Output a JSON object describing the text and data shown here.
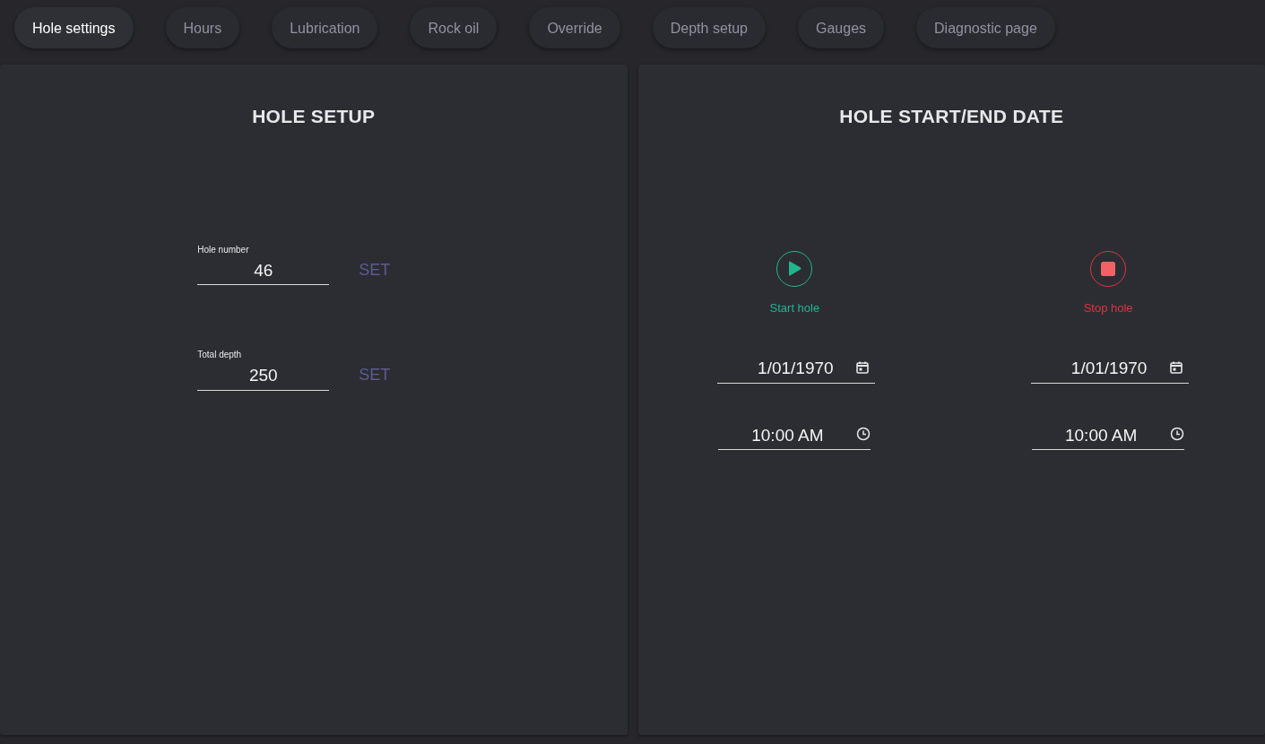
{
  "tabs": [
    {
      "label": "Hole settings",
      "selected": true
    },
    {
      "label": "Hours",
      "selected": false
    },
    {
      "label": "Lubrication",
      "selected": false
    },
    {
      "label": "Rock oil",
      "selected": false
    },
    {
      "label": "Override",
      "selected": false
    },
    {
      "label": "Depth setup",
      "selected": false
    },
    {
      "label": "Gauges",
      "selected": false
    },
    {
      "label": "Diagnostic page",
      "selected": false
    }
  ],
  "hole_setup": {
    "title": "HOLE SETUP",
    "fields": [
      {
        "label": "Hole number",
        "value": "46",
        "button": "SET",
        "disabled": true
      },
      {
        "label": "Total depth",
        "value": "250",
        "button": "SET",
        "disabled": true
      }
    ]
  },
  "hole_dates": {
    "title": "HOLE START/END DATE",
    "columns": [
      {
        "kind": "start",
        "label": "Start hole",
        "color": "#21b58c",
        "date": "1/01/1970",
        "time": "10:00 AM"
      },
      {
        "kind": "stop",
        "label": "Stop hole",
        "color": "#e0343c",
        "date": "1/01/1970",
        "time": "10:00 AM"
      }
    ]
  }
}
